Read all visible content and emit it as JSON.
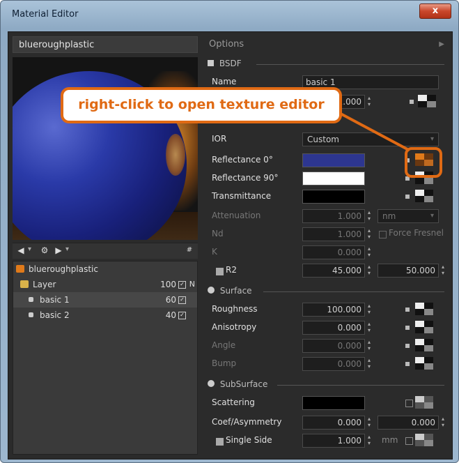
{
  "window": {
    "title": "Material Editor",
    "close": "x"
  },
  "left": {
    "material_name": "blueroughplastic",
    "tree": [
      {
        "label": "blueroughplastic",
        "value": "",
        "check": false,
        "n": ""
      },
      {
        "label": "Layer",
        "value": "100",
        "check": true,
        "n": "N"
      },
      {
        "label": "basic 1",
        "value": "60",
        "check": true,
        "n": ""
      },
      {
        "label": "basic 2",
        "value": "40",
        "check": true,
        "n": ""
      }
    ]
  },
  "right": {
    "options": "Options",
    "bsdf": "BSDF",
    "name_label": "Name",
    "name_value": "basic 1",
    "weight_value": "1.000",
    "ior_label": "IOR",
    "ior_value": "Custom",
    "reflectance0": "Reflectance 0°",
    "reflectance90": "Reflectance 90°",
    "transmittance": "Transmittance",
    "attenuation": "Attenuation",
    "attenuation_value": "1.000",
    "attenuation_unit": "nm",
    "nd": "Nd",
    "nd_value": "1.000",
    "force_fresnel": "Force Fresnel",
    "k": "K",
    "k_value": "0.000",
    "r2": "R2",
    "r2_value1": "45.000",
    "r2_value2": "50.000",
    "surface": "Surface",
    "roughness": "Roughness",
    "roughness_value": "100.000",
    "anisotropy": "Anisotropy",
    "anisotropy_value": "0.000",
    "angle": "Angle",
    "angle_value": "0.000",
    "bump": "Bump",
    "bump_value": "0.000",
    "subsurface": "SubSurface",
    "scattering": "Scattering",
    "coef": "Coef/Asymmetry",
    "coef_value1": "0.000",
    "coef_value2": "0.000",
    "single_side": "Single Side",
    "single_side_value": "1.000",
    "single_side_unit": "mm"
  },
  "callout": {
    "text": "right-click to open texture editor"
  },
  "colors": {
    "reflectance0": "#2d3690",
    "reflectance90": "#ffffff",
    "transmittance": "#000000",
    "scattering": "#000000",
    "accent": "#e06a14"
  }
}
